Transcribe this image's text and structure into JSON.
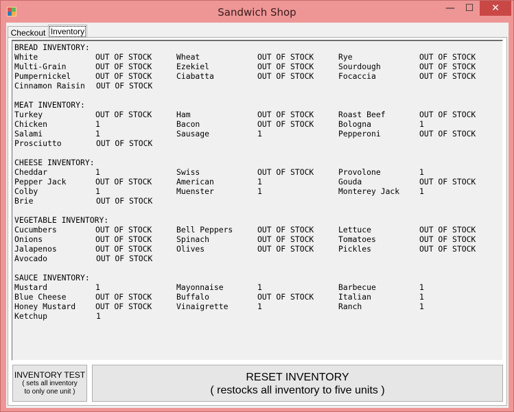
{
  "window": {
    "title": "Sandwich Shop"
  },
  "tabs": [
    {
      "label": "Checkout"
    },
    {
      "label": "Inventory"
    }
  ],
  "inventory": {
    "sections": [
      {
        "header": "BREAD INVENTORY:",
        "rows": [
          [
            [
              "White",
              "OUT OF STOCK"
            ],
            [
              "Wheat",
              "OUT OF STOCK"
            ],
            [
              "Rye",
              "OUT OF STOCK"
            ]
          ],
          [
            [
              "Multi-Grain",
              "OUT OF STOCK"
            ],
            [
              "Ezekiel",
              "OUT OF STOCK"
            ],
            [
              "Sourdough",
              "OUT OF STOCK"
            ]
          ],
          [
            [
              "Pumpernickel",
              "OUT OF STOCK"
            ],
            [
              "Ciabatta",
              "OUT OF STOCK"
            ],
            [
              "Focaccia",
              "OUT OF STOCK"
            ]
          ],
          [
            [
              "Cinnamon Raisin",
              "OUT OF STOCK"
            ]
          ]
        ]
      },
      {
        "header": "MEAT INVENTORY:",
        "rows": [
          [
            [
              "Turkey",
              "OUT OF STOCK"
            ],
            [
              "Ham",
              "OUT OF STOCK"
            ],
            [
              "Roast Beef",
              "OUT OF STOCK"
            ]
          ],
          [
            [
              "Chicken",
              "1"
            ],
            [
              "Bacon",
              "OUT OF STOCK"
            ],
            [
              "Bologna",
              "1"
            ]
          ],
          [
            [
              "Salami",
              "1"
            ],
            [
              "Sausage",
              "1"
            ],
            [
              "Pepperoni",
              "OUT OF STOCK"
            ]
          ],
          [
            [
              "Prosciutto",
              "OUT OF STOCK"
            ]
          ]
        ]
      },
      {
        "header": "CHEESE INVENTORY:",
        "rows": [
          [
            [
              "Cheddar",
              "1"
            ],
            [
              "Swiss",
              "OUT OF STOCK"
            ],
            [
              "Provolone",
              "1"
            ]
          ],
          [
            [
              "Pepper Jack",
              "OUT OF STOCK"
            ],
            [
              "American",
              "1"
            ],
            [
              "Gouda",
              "OUT OF STOCK"
            ]
          ],
          [
            [
              "Colby",
              "1"
            ],
            [
              "Muenster",
              "1"
            ],
            [
              "Monterey Jack",
              "1"
            ]
          ],
          [
            [
              "Brie",
              "OUT OF STOCK"
            ]
          ]
        ]
      },
      {
        "header": "VEGETABLE INVENTORY:",
        "rows": [
          [
            [
              "Cucumbers",
              "OUT OF STOCK"
            ],
            [
              "Bell Peppers",
              "OUT OF STOCK"
            ],
            [
              "Lettuce",
              "OUT OF STOCK"
            ]
          ],
          [
            [
              "Onions",
              "OUT OF STOCK"
            ],
            [
              "Spinach",
              "OUT OF STOCK"
            ],
            [
              "Tomatoes",
              "OUT OF STOCK"
            ]
          ],
          [
            [
              "Jalapenos",
              "OUT OF STOCK"
            ],
            [
              "Olives",
              "OUT OF STOCK"
            ],
            [
              "Pickles",
              "OUT OF STOCK"
            ]
          ],
          [
            [
              "Avocado",
              "OUT OF STOCK"
            ]
          ]
        ]
      },
      {
        "header": "SAUCE INVENTORY:",
        "rows": [
          [
            [
              "Mustard",
              "1"
            ],
            [
              "Mayonnaise",
              "1"
            ],
            [
              "Barbecue",
              "1"
            ]
          ],
          [
            [
              "Blue Cheese",
              "OUT OF STOCK"
            ],
            [
              "Buffalo",
              "OUT OF STOCK"
            ],
            [
              "Italian",
              "1"
            ]
          ],
          [
            [
              "Honey Mustard",
              "OUT OF STOCK"
            ],
            [
              "Vinaigrette",
              "1"
            ],
            [
              "Ranch",
              "1"
            ]
          ],
          [
            [
              "Ketchup",
              "1"
            ]
          ]
        ]
      }
    ]
  },
  "buttons": {
    "test": {
      "line1": "INVENTORY TEST",
      "line2": "( sets all inventory",
      "line3": "to only one unit )"
    },
    "reset": {
      "line1": "RESET INVENTORY",
      "line2": "( restocks all inventory to five units )"
    }
  }
}
